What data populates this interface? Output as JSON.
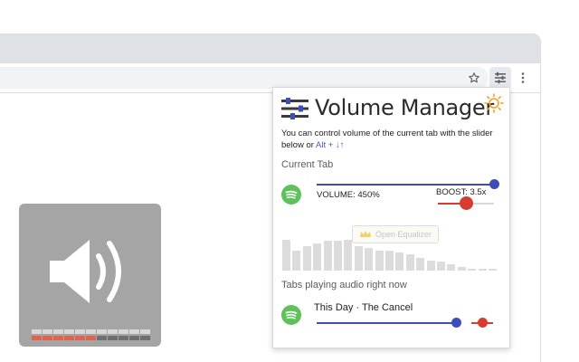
{
  "popup": {
    "title": "Volume Manager",
    "description": "You can control volume of the current tab with the slider below or ",
    "hotkey": "Alt + ↓↑",
    "current_tab_label": "Current Tab",
    "volume_label": "VOLUME: 450%",
    "volume_fraction": 1.0,
    "boost_label": "BOOST: 3.5x",
    "boost_fraction": 0.5,
    "equalizer_button": "Open Equalizer",
    "equalizer_levels": [
      0.78,
      0.5,
      0.62,
      0.68,
      0.76,
      0.74,
      0.78,
      0.62,
      0.56,
      0.5,
      0.5,
      0.46,
      0.4,
      0.32,
      0.24,
      0.22,
      0.16,
      0.08,
      0.04,
      0.04,
      0.04
    ],
    "playing_label": "Tabs playing audio right now",
    "tracks": [
      {
        "title": "This Day · The Cancel",
        "volume_fraction": 1.0,
        "boost_fraction": 0.5
      }
    ]
  },
  "overlay": {
    "meter_total": 11,
    "meter_filled": 6
  },
  "colors": {
    "accent_blue": "#3e4db8",
    "accent_red": "#d63d2f",
    "spotify_green": "#5dc25a",
    "sun_orange": "#f2a12a",
    "overlay_bg": "#a5a5a5"
  },
  "icons": {
    "toolbar": [
      "star-icon",
      "sliders-extension-icon",
      "more-vert-icon"
    ],
    "popup": [
      "sliders-logo-icon",
      "sun-icon",
      "spotify-icon",
      "crown-icon"
    ],
    "overlay": [
      "speaker-icon"
    ]
  }
}
